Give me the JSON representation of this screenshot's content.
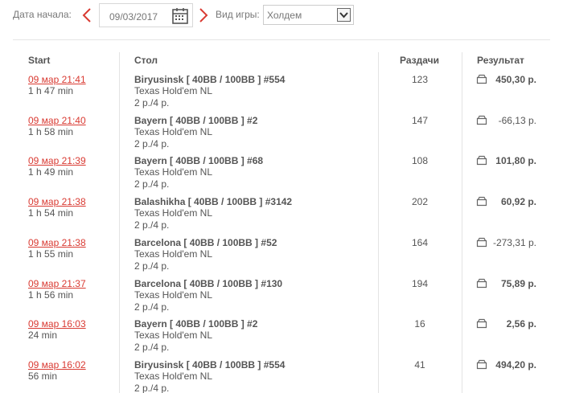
{
  "filters": {
    "start_label": "Дата начала:",
    "date_value": "09/03/2017",
    "game_type_label": "Вид игры:",
    "game_type_value": "Холдем"
  },
  "table": {
    "headers": {
      "start": "Start",
      "table": "Стол",
      "hands": "Раздачи",
      "result": "Результат"
    },
    "rows": [
      {
        "date": "09 мар 21:41",
        "duration": "1 h 47 min",
        "name": "Biryusinsk [ 40BB / 100BB ] #554",
        "game": "Texas Hold'em NL",
        "stakes": "2 р./4 р.",
        "hands": "123",
        "result": "450,30 р.",
        "positive": true
      },
      {
        "date": "09 мар 21:40",
        "duration": "1 h 58 min",
        "name": "Bayern [ 40BB / 100BB ] #2",
        "game": "Texas Hold'em NL",
        "stakes": "2 р./4 р.",
        "hands": "147",
        "result": "-66,13 р.",
        "positive": false
      },
      {
        "date": "09 мар 21:39",
        "duration": "1 h 49 min",
        "name": "Bayern [ 40BB / 100BB ] #68",
        "game": "Texas Hold'em NL",
        "stakes": "2 р./4 р.",
        "hands": "108",
        "result": "101,80 р.",
        "positive": true
      },
      {
        "date": "09 мар 21:38",
        "duration": "1 h 54 min",
        "name": "Balashikha [ 40BB / 100BB ] #3142",
        "game": "Texas Hold'em NL",
        "stakes": "2 р./4 р.",
        "hands": "202",
        "result": "60,92 р.",
        "positive": true
      },
      {
        "date": "09 мар 21:38",
        "duration": "1 h 55 min",
        "name": "Barcelona [ 40BB / 100BB ] #52",
        "game": "Texas Hold'em NL",
        "stakes": "2 р./4 р.",
        "hands": "164",
        "result": "-273,31 р.",
        "positive": false
      },
      {
        "date": "09 мар 21:37",
        "duration": "1 h 56 min",
        "name": "Barcelona [ 40BB / 100BB ] #130",
        "game": "Texas Hold'em NL",
        "stakes": "2 р./4 р.",
        "hands": "194",
        "result": "75,89 р.",
        "positive": true
      },
      {
        "date": "09 мар 16:03",
        "duration": "24 min",
        "name": "Bayern [ 40BB / 100BB ] #2",
        "game": "Texas Hold'em NL",
        "stakes": "2 р./4 р.",
        "hands": "16",
        "result": "2,56 р.",
        "positive": true
      },
      {
        "date": "09 мар 16:02",
        "duration": "56 min",
        "name": "Biryusinsk [ 40BB / 100BB ] #554",
        "game": "Texas Hold'em NL",
        "stakes": "2 р./4 р.",
        "hands": "41",
        "result": "494,20 р.",
        "positive": true
      }
    ]
  },
  "colors": {
    "accent": "#d93a32",
    "text": "#555555",
    "divider": "#e3e3e3"
  },
  "icons": {
    "prev": "chevron-left-icon",
    "next": "chevron-right-icon",
    "calendar": "calendar-icon",
    "dropdown": "dropdown-arrow-icon",
    "row_result": "wallet-icon"
  }
}
